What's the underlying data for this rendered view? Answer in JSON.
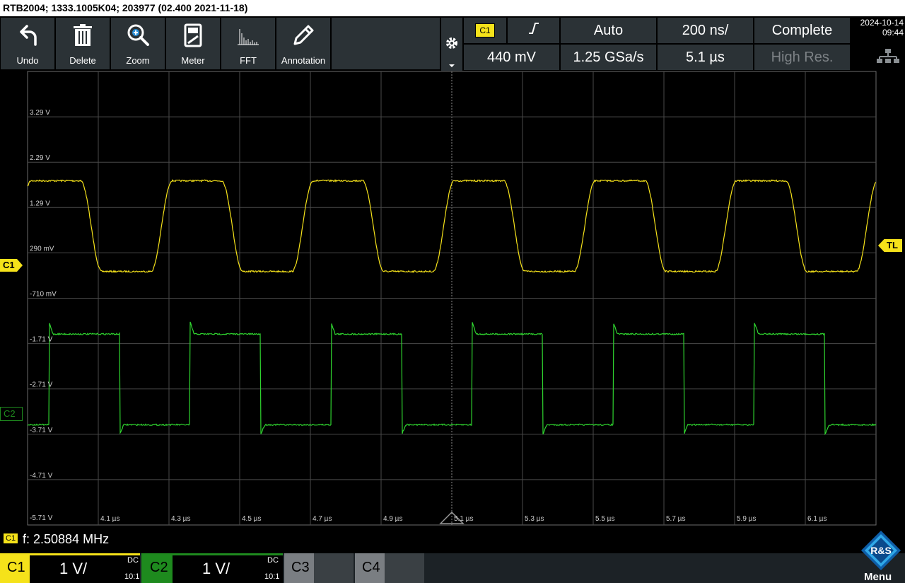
{
  "title_bar": "RTB2004; 1333.1005K04; 203977 (02.400 2021-11-18)",
  "toolbar": {
    "undo": "Undo",
    "delete": "Delete",
    "zoom": "Zoom",
    "meter": "Meter",
    "fft": "FFT",
    "annotation": "Annotation"
  },
  "settings": {
    "trigger_source": "C1",
    "trigger_mode": "Auto",
    "timebase": "200 ns/",
    "acq_state": "Complete",
    "trigger_level": "440 mV",
    "sample_rate": "1.25 GSa/s",
    "horizontal_position": "5.1 µs",
    "acq_mode": "High Res."
  },
  "datetime": {
    "date": "2024-10-14",
    "time": "09:44"
  },
  "y_ticks": [
    "3.29 V",
    "2.29 V",
    "1.29 V",
    "290 mV",
    "-710 mV",
    "-1.71 V",
    "-2.71 V",
    "-3.71 V",
    "-4.71 V",
    "-5.71 V"
  ],
  "x_ticks": [
    "4.1 µs",
    "4.3 µs",
    "4.5 µs",
    "4.7 µs",
    "4.9 µs",
    "5.1 µs",
    "5.3 µs",
    "5.5 µs",
    "5.7 µs",
    "5.9 µs",
    "6.1 µs"
  ],
  "markers": {
    "c1": "C1",
    "c2": "C2",
    "tl": "TL"
  },
  "measurement": {
    "badge": "C1",
    "text": "f: 2.50884 MHz"
  },
  "channels": [
    {
      "label": "C1",
      "scale": "1 V/",
      "coupling": "DC",
      "probe": "10:1",
      "color": "#f5e21a"
    },
    {
      "label": "C2",
      "scale": "1 V/",
      "coupling": "DC",
      "probe": "10:1",
      "color": "#1e8a1e"
    },
    {
      "label": "C3"
    },
    {
      "label": "C4"
    }
  ],
  "menu_label": "Menu",
  "chart_data": {
    "type": "line",
    "x_unit": "µs",
    "y_unit": "V",
    "xlim": [
      4.1,
      6.1
    ],
    "ylim": [
      -5.71,
      3.29
    ],
    "series": [
      {
        "name": "C1",
        "color": "#f5e21a",
        "low": -0.12,
        "high": 1.88,
        "period_us": 0.399,
        "first_rise_us": 3.85,
        "rise_us": 0.06,
        "high_width_us": 0.14
      },
      {
        "name": "C2",
        "color": "#2fd42f",
        "low": -3.5,
        "high": -1.5,
        "period_us": 0.399,
        "first_rise_us": 3.96,
        "high_width_us": 0.2
      }
    ]
  }
}
